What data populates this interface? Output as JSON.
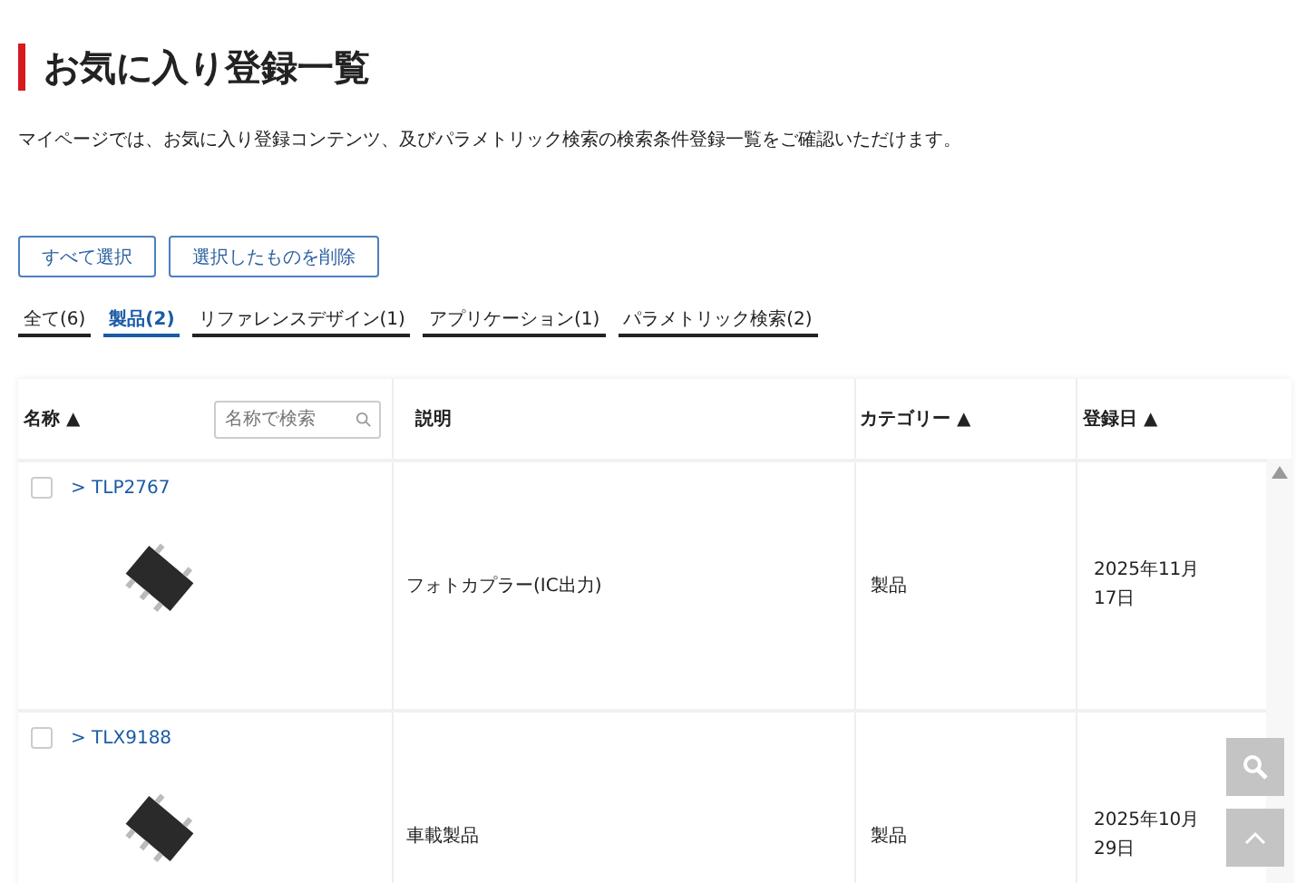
{
  "page": {
    "title": "お気に入り登録一覧",
    "description": "マイページでは、お気に入り登録コンテンツ、及びパラメトリック検索の検索条件登録一覧をご確認いただけます。"
  },
  "buttons": [
    "すべて選択",
    "選択したものを削除"
  ],
  "tabs": [
    {
      "label": "全て(6)",
      "selected": false
    },
    {
      "label": "製品(2)",
      "selected": true
    },
    {
      "label": "リファレンスデザイン(1)",
      "selected": false
    },
    {
      "label": "アプリケーション(1)",
      "selected": false
    },
    {
      "label": "パラメトリック検索(2)",
      "selected": false
    }
  ],
  "table": {
    "columns": [
      "名称 ▲",
      "説明",
      "カテゴリー ▲",
      "登録日 ▲"
    ],
    "search": {
      "placeholder": "名称で検索"
    },
    "rows": [
      {
        "name": "> TLP2767",
        "checked": false,
        "description": "フォトカプラー(IC出力)",
        "category": "製品",
        "date": "2025年11月17日"
      },
      {
        "name": "> TLX9188",
        "checked": false,
        "description": "車載製品",
        "category": "製品",
        "date": "2025年10月29日"
      }
    ]
  }
}
